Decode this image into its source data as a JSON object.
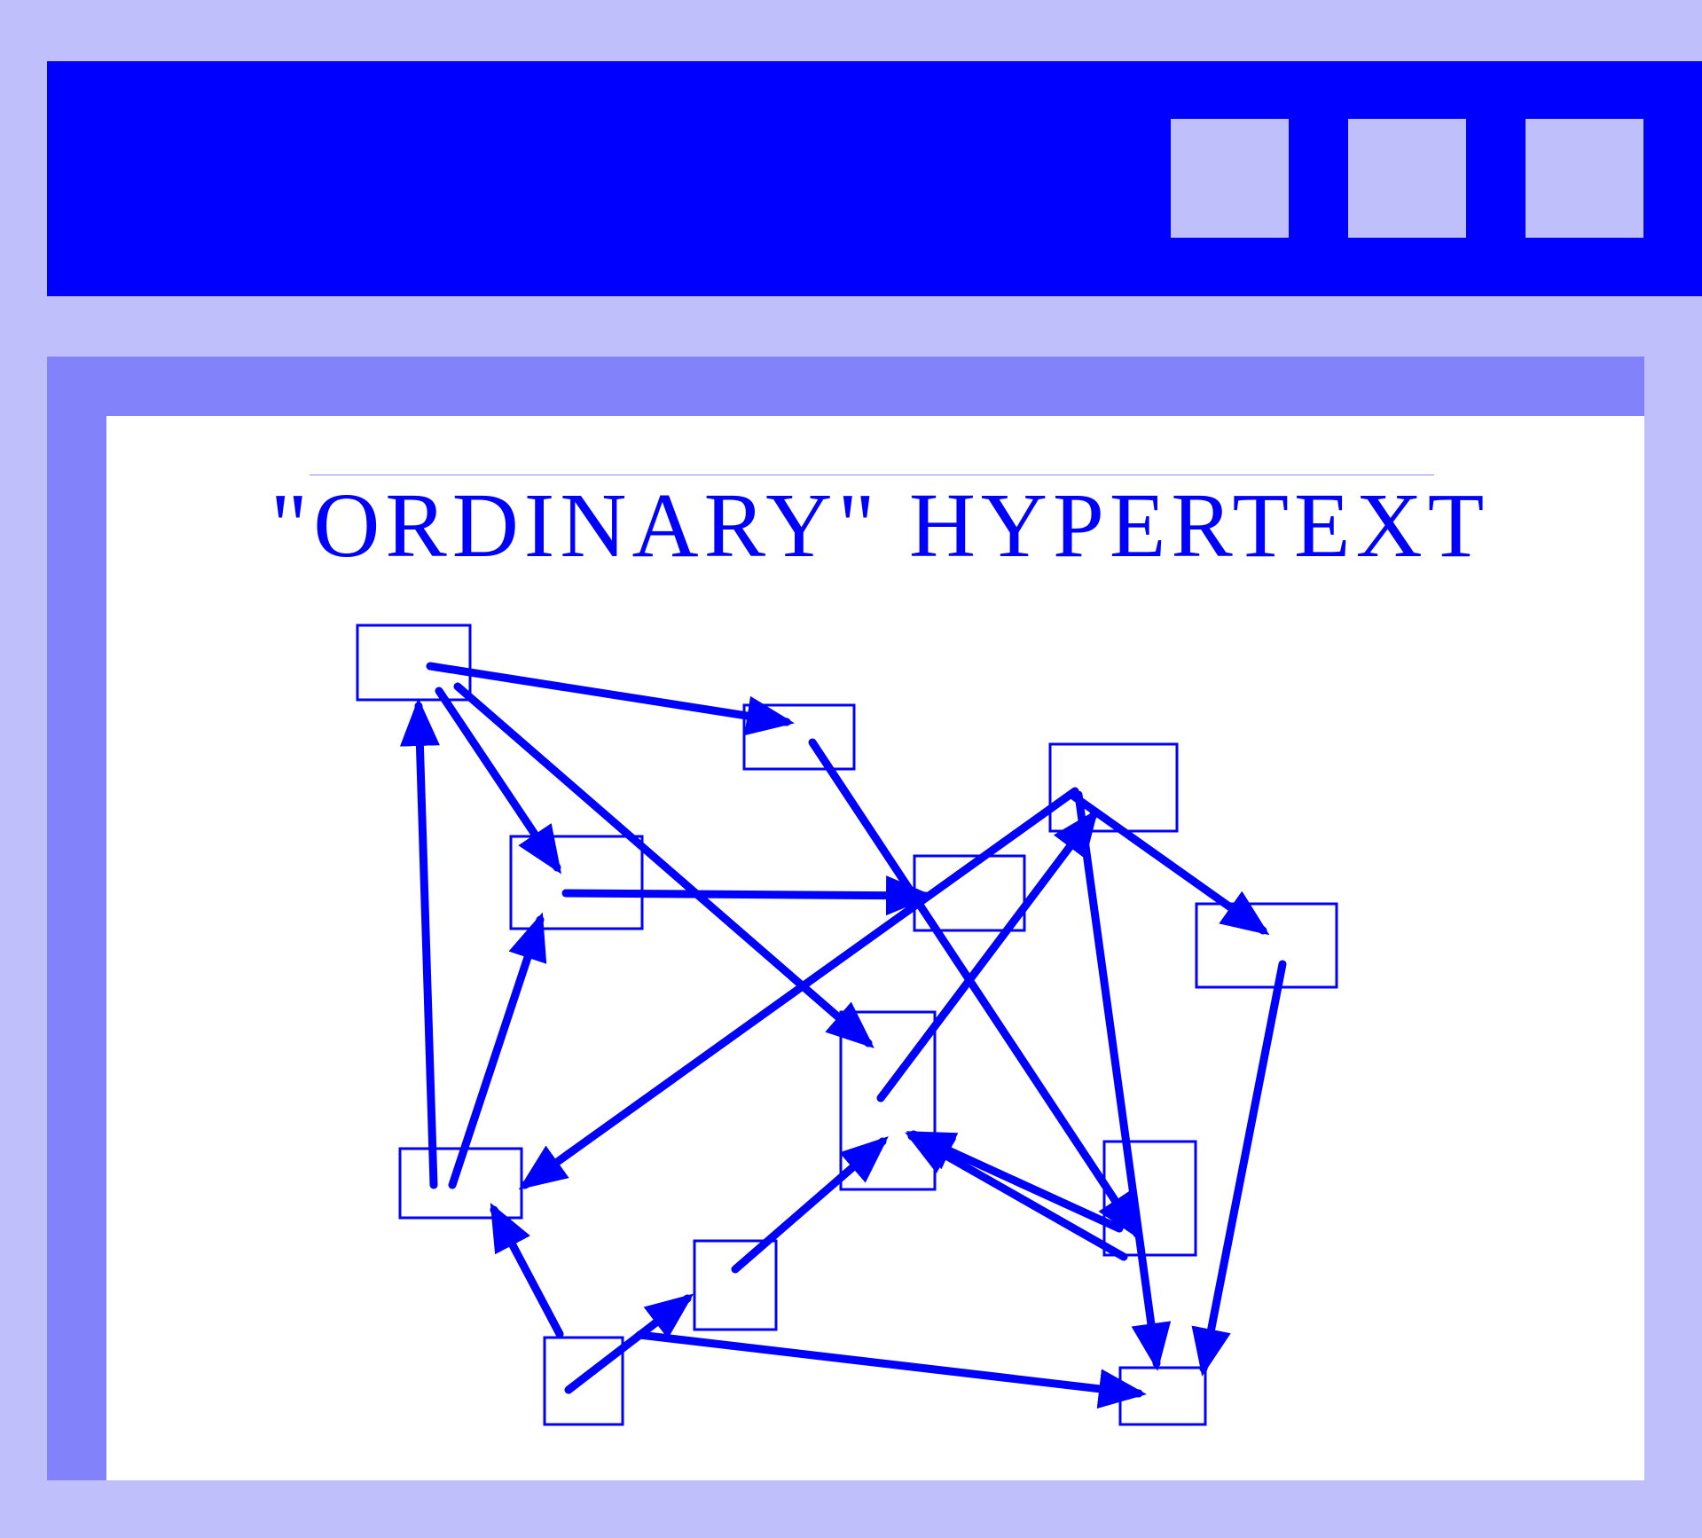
{
  "window": {
    "title": "",
    "colors": {
      "background": "#bfbffb",
      "titlebar": "#0000ff",
      "pane_border": "#8282fb",
      "canvas": "#ffffff",
      "ink": "#0000ff"
    },
    "controls": [
      "minimize-button",
      "maximize-button",
      "close-button"
    ]
  },
  "diagram": {
    "title": "\"ORDINARY\" HYPERTEXT",
    "nodes": [
      "n1",
      "n2",
      "n3",
      "n4",
      "n5",
      "n6",
      "n7",
      "n8",
      "n9",
      "n10",
      "n11",
      "n12"
    ],
    "links": [
      {
        "from": "n1",
        "to": "n2"
      },
      {
        "from": "n1",
        "to": "n3"
      },
      {
        "from": "n1",
        "to": "n7"
      },
      {
        "from": "n2",
        "to": "n11"
      },
      {
        "from": "n3",
        "to": "n5"
      },
      {
        "from": "n4",
        "to": "n6"
      },
      {
        "from": "n4",
        "to": "n8"
      },
      {
        "from": "n4",
        "to": "n12"
      },
      {
        "from": "n7",
        "to": "n4"
      },
      {
        "from": "n8",
        "to": "n1"
      },
      {
        "from": "n8",
        "to": "n3"
      },
      {
        "from": "n9",
        "to": "n8"
      },
      {
        "from": "n9",
        "to": "n10"
      },
      {
        "from": "n10",
        "to": "n7"
      },
      {
        "from": "n10",
        "to": "n12"
      },
      {
        "from": "n11",
        "to": "n7"
      },
      {
        "from": "n6",
        "to": "n12"
      }
    ]
  }
}
